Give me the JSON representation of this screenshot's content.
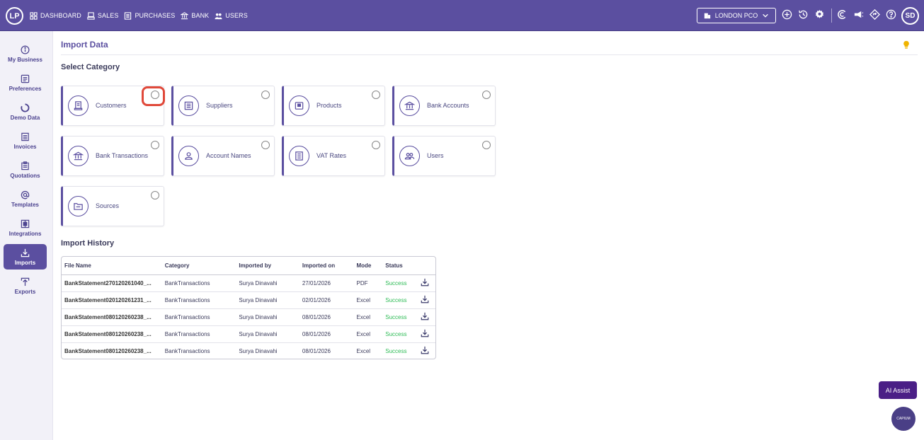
{
  "brand": {
    "initials": "LP"
  },
  "topnav": [
    {
      "label": "DASHBOARD",
      "icon": "grid-icon"
    },
    {
      "label": "SALES",
      "icon": "register-icon"
    },
    {
      "label": "PURCHASES",
      "icon": "document-icon"
    },
    {
      "label": "BANK",
      "icon": "bank-icon"
    },
    {
      "label": "USERS",
      "icon": "users-icon"
    }
  ],
  "company": {
    "name": "LONDON PCO"
  },
  "user": {
    "initials": "SD"
  },
  "sidebar": [
    {
      "label": "My Business",
      "icon": "info-icon"
    },
    {
      "label": "Preferences",
      "icon": "preferences-icon"
    },
    {
      "label": "Demo Data",
      "icon": "donut-icon"
    },
    {
      "label": "Invoices",
      "icon": "invoice-icon"
    },
    {
      "label": "Quotations",
      "icon": "quotation-icon"
    },
    {
      "label": "Templates",
      "icon": "at-icon"
    },
    {
      "label": "Integrations",
      "icon": "integrations-icon"
    },
    {
      "label": "Imports",
      "icon": "import-icon",
      "active": true
    },
    {
      "label": "Exports",
      "icon": "export-icon"
    }
  ],
  "page": {
    "title": "Import Data",
    "select_category": "Select Category",
    "import_history": "Import History"
  },
  "categories": [
    {
      "label": "Customers",
      "icon": "customers-icon"
    },
    {
      "label": "Suppliers",
      "icon": "suppliers-icon"
    },
    {
      "label": "Products",
      "icon": "products-icon"
    },
    {
      "label": "Bank Accounts",
      "icon": "bank-icon"
    },
    {
      "label": "Bank Transactions",
      "icon": "bank-icon"
    },
    {
      "label": "Account Names",
      "icon": "account-icon"
    },
    {
      "label": "VAT Rates",
      "icon": "vat-icon"
    },
    {
      "label": "Users",
      "icon": "users-icon"
    },
    {
      "label": "Sources",
      "icon": "folder-icon"
    }
  ],
  "history": {
    "columns": [
      "File Name",
      "Category",
      "Imported by",
      "Imported on",
      "Mode",
      "Status"
    ],
    "rows": [
      [
        "BankStatement270120261040_...",
        "BankTransactions",
        "Surya Dinavahi",
        "27/01/2026",
        "PDF",
        "Success"
      ],
      [
        "BankStatement020120261231_...",
        "BankTransactions",
        "Surya Dinavahi",
        "02/01/2026",
        "Excel",
        "Success"
      ],
      [
        "BankStatement080120260238_...",
        "BankTransactions",
        "Surya Dinavahi",
        "08/01/2026",
        "Excel",
        "Success"
      ],
      [
        "BankStatement080120260238_...",
        "BankTransactions",
        "Surya Dinavahi",
        "08/01/2026",
        "Excel",
        "Success"
      ],
      [
        "BankStatement080120260238_...",
        "BankTransactions",
        "Surya Dinavahi",
        "08/01/2026",
        "Excel",
        "Success"
      ]
    ]
  },
  "ai_assist": {
    "label": "AI Assist"
  },
  "chat": {
    "label": "CAPIUM"
  },
  "colors": {
    "primary": "#5b4fa0",
    "success": "#2dbb55",
    "highlight": "#e0493a",
    "ai": "#4a1f86"
  }
}
